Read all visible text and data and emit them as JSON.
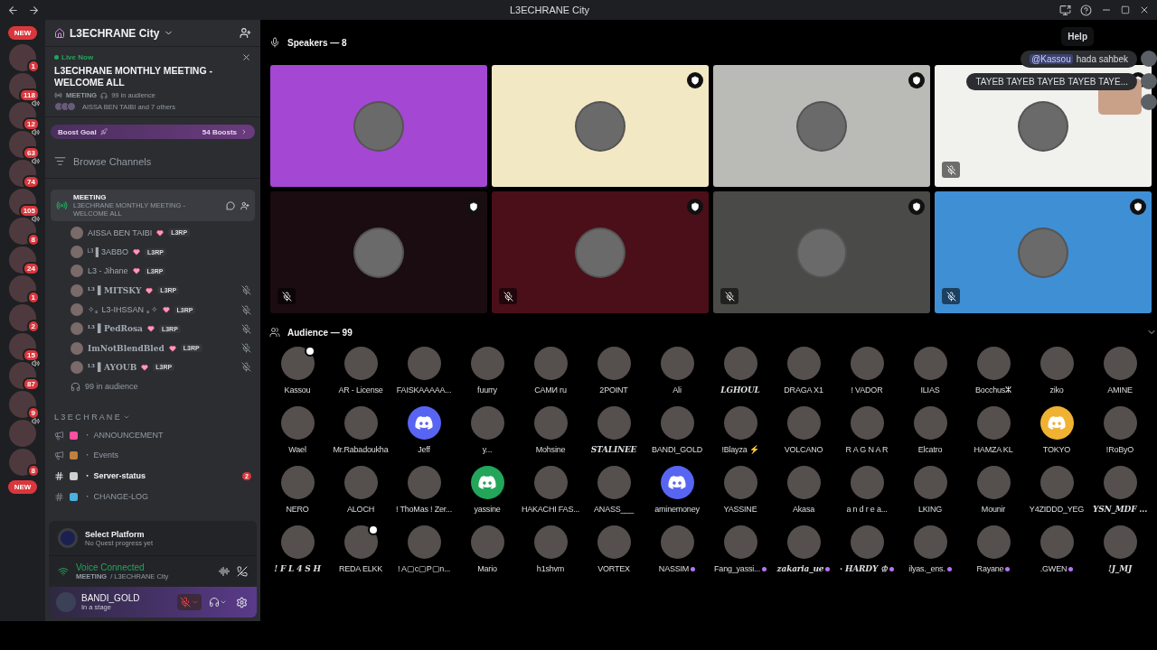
{
  "window": {
    "title": "L3ECHRANE City",
    "tooltip": "Help"
  },
  "rail": [
    {
      "kind": "new",
      "label": "NEW"
    },
    {
      "kind": "server",
      "badge": "1",
      "speaker": false
    },
    {
      "kind": "server",
      "badge": "118",
      "speaker": false
    },
    {
      "kind": "server",
      "badge": "12",
      "speaker": true
    },
    {
      "kind": "server",
      "badge": "63",
      "speaker": true
    },
    {
      "kind": "server",
      "badge": "74",
      "speaker": true
    },
    {
      "kind": "server",
      "badge": "105",
      "speaker": false
    },
    {
      "kind": "server",
      "badge": "8",
      "speaker": true
    },
    {
      "kind": "server",
      "badge": "24",
      "speaker": false
    },
    {
      "kind": "server",
      "badge": "1",
      "speaker": false
    },
    {
      "kind": "server",
      "badge": "2",
      "speaker": false
    },
    {
      "kind": "server",
      "badge": "15",
      "speaker": false
    },
    {
      "kind": "server",
      "badge": "87",
      "speaker": true
    },
    {
      "kind": "server",
      "badge": "9",
      "speaker": false
    },
    {
      "kind": "server",
      "speaker": true
    },
    {
      "kind": "server",
      "badge": "8",
      "speaker": false
    },
    {
      "kind": "new",
      "label": "NEW"
    }
  ],
  "sidebar": {
    "server_name": "L3ECHRANE City",
    "event": {
      "status": "Live Now",
      "title": "L3ECHRANE MONTHLY MEETING - WELCOME ALL",
      "channel": "MEETING",
      "audience": "99 in audience",
      "people": "AISSA BEN TAIBI and 7 others"
    },
    "boost": {
      "label": "Boost Goal",
      "count": "54 Boosts"
    },
    "browse": "Browse Channels",
    "stage": {
      "name": "MEETING",
      "topic": "L3ECHRANE MONTHLY MEETING - WELCOME ALL",
      "selected": true,
      "members": [
        {
          "name": "AISSA BEN TAIBI",
          "tag": "L3RP",
          "muted": false,
          "fancy": false
        },
        {
          "name": "ᴸ³ ▌3ABBO",
          "tag": "L3RP",
          "muted": false,
          "fancy": false
        },
        {
          "name": "L3 - Jihane",
          "tag": "L3RP",
          "muted": false,
          "fancy": false
        },
        {
          "name": "ᴸ³ ▌MITSKY",
          "tag": "L3RP",
          "muted": true,
          "fancy": true
        },
        {
          "name": "✧｡ L3-IHSSAN ｡✧",
          "tag": "L3RP",
          "muted": true,
          "fancy": false
        },
        {
          "name": "ᴸ³ ▌PedRosa",
          "tag": "L3RP",
          "muted": true,
          "fancy": true
        },
        {
          "name": "ImNotBlendBled",
          "tag": "L3RP",
          "muted": true,
          "fancy": true
        },
        {
          "name": "ᴸ³ ▌AYOUB",
          "tag": "L3RP",
          "muted": true,
          "fancy": true
        }
      ],
      "audience": "99 in audience"
    },
    "category": "L 3 E C H R A N E",
    "channels": [
      {
        "kind": "announcement",
        "name": "・ ANNOUNCEMENT",
        "unread": false
      },
      {
        "kind": "announcement",
        "name": "・ Events",
        "unread": false
      },
      {
        "kind": "text",
        "name": "・ Server-status",
        "unread": true,
        "badge": "2"
      },
      {
        "kind": "text",
        "name": "・ CHANGE-LOG",
        "unread": false
      }
    ],
    "quest": {
      "title": "Select Platform",
      "subtitle": "No Quest progress yet"
    },
    "voice": {
      "status": "Voice Connected",
      "channel": "MEETING",
      "server": "/ L3ECHRANE City"
    },
    "user": {
      "name": "BANDI_GOLD",
      "status": "In a stage",
      "mic_muted": true
    }
  },
  "chat": [
    {
      "mention": "@Kassou",
      "text": "hada sahbek"
    },
    {
      "text": "TAYEB TAYEB TAYEB TAYEB TAYE..."
    }
  ],
  "stage": {
    "speakers_label": "Speakers — 8",
    "audience_label": "Audience — 99",
    "speakers": [
      {
        "color": "#a447d3",
        "moderator": false,
        "muted": false
      },
      {
        "color": "#f3e8c4",
        "moderator": true,
        "muted": false
      },
      {
        "color": "#babbb7",
        "moderator": true,
        "muted": false
      },
      {
        "color": "#f1f1ee",
        "moderator": true,
        "muted": true
      },
      {
        "color": "#1b0c11",
        "moderator": true,
        "muted": true
      },
      {
        "color": "#4b0f19",
        "moderator": true,
        "muted": true
      },
      {
        "color": "#4a4a48",
        "moderator": true,
        "muted": true
      },
      {
        "color": "#3f8fd5",
        "moderator": true,
        "muted": true
      }
    ],
    "audience": [
      {
        "name": "Kassou",
        "moderator": true
      },
      {
        "name": "AR - License"
      },
      {
        "name": "FAISKAAAAA..."
      },
      {
        "name": "fuurry"
      },
      {
        "name": "САМИ ru"
      },
      {
        "name": "2POINT"
      },
      {
        "name": "Ali"
      },
      {
        "name": "LGHOUL",
        "fancy": true
      },
      {
        "name": "DRAGA X1"
      },
      {
        "name": "! VADOR"
      },
      {
        "name": "ILIAS"
      },
      {
        "name": "Bocchusⵣ"
      },
      {
        "name": "ziko"
      },
      {
        "name": "AMINE"
      },
      {
        "name": "Wael"
      },
      {
        "name": "Mr.Rabadoukha"
      },
      {
        "name": "Jeff",
        "color": "#5865f2"
      },
      {
        "name": "y..."
      },
      {
        "name": "Mohsine"
      },
      {
        "name": "STALINEE",
        "fancy": true
      },
      {
        "name": "BANDI_GOLD"
      },
      {
        "name": "!Blayza ⚡"
      },
      {
        "name": "VOLCANO"
      },
      {
        "name": "R A G N A R"
      },
      {
        "name": "Elcatro"
      },
      {
        "name": "HAMZA KL"
      },
      {
        "name": "TOKYO",
        "color": "#f0b232"
      },
      {
        "name": "!RoByO"
      },
      {
        "name": "NERO"
      },
      {
        "name": "ALOCH"
      },
      {
        "name": "! ThoMas ! Zer..."
      },
      {
        "name": "yassine",
        "color": "#23a55a"
      },
      {
        "name": "HAKACHI FAS..."
      },
      {
        "name": "ANASS___"
      },
      {
        "name": "aminemoney",
        "color": "#5865f2"
      },
      {
        "name": "YASSINE"
      },
      {
        "name": "Akasa"
      },
      {
        "name": "a n d r e a..."
      },
      {
        "name": "LKING"
      },
      {
        "name": "Mounir"
      },
      {
        "name": "Y4ZIDDD_YEG"
      },
      {
        "name": "YSN_MDF ...",
        "fancy": true
      },
      {
        "name": "! F L 4 S H",
        "fancy": true
      },
      {
        "name": "REDA ELKK",
        "moderator": true
      },
      {
        "name": "! A▢c▢P▢n..."
      },
      {
        "name": "Mario"
      },
      {
        "name": "h1shvm"
      },
      {
        "name": "VORTEX"
      },
      {
        "name": "NASSIM",
        "boost": true
      },
      {
        "name": "Fang_yassi...",
        "boost": true
      },
      {
        "name": "zakaria_ue",
        "boost": true,
        "fancy": true
      },
      {
        "name": "· HARDY ♔",
        "boost": true,
        "fancy": true
      },
      {
        "name": "ilyas._ens.",
        "boost": true
      },
      {
        "name": "Rayane",
        "boost": true
      },
      {
        "name": ".GWEN",
        "boost": true
      },
      {
        "name": "!J_MJ",
        "fancy": true
      }
    ]
  }
}
